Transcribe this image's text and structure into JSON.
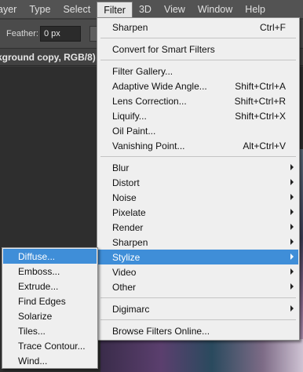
{
  "menubar": {
    "items": [
      "ayer",
      "Type",
      "Select",
      "Filter",
      "3D",
      "View",
      "Window",
      "Help"
    ],
    "active": "Filter"
  },
  "options": {
    "feather_label": "Feather:",
    "feather_value": "0 px"
  },
  "document": {
    "title": "kground copy, RGB/8) *"
  },
  "filter_menu": {
    "sections": [
      [
        {
          "label": "Sharpen",
          "shortcut": "Ctrl+F"
        }
      ],
      [
        {
          "label": "Convert for Smart Filters"
        }
      ],
      [
        {
          "label": "Filter Gallery..."
        },
        {
          "label": "Adaptive Wide Angle...",
          "shortcut": "Shift+Ctrl+A"
        },
        {
          "label": "Lens Correction...",
          "shortcut": "Shift+Ctrl+R"
        },
        {
          "label": "Liquify...",
          "shortcut": "Shift+Ctrl+X"
        },
        {
          "label": "Oil Paint..."
        },
        {
          "label": "Vanishing Point...",
          "shortcut": "Alt+Ctrl+V"
        }
      ],
      [
        {
          "label": "Blur",
          "submenu": true
        },
        {
          "label": "Distort",
          "submenu": true
        },
        {
          "label": "Noise",
          "submenu": true
        },
        {
          "label": "Pixelate",
          "submenu": true
        },
        {
          "label": "Render",
          "submenu": true
        },
        {
          "label": "Sharpen",
          "submenu": true
        },
        {
          "label": "Stylize",
          "submenu": true,
          "highlighted": true
        },
        {
          "label": "Video",
          "submenu": true
        },
        {
          "label": "Other",
          "submenu": true
        }
      ],
      [
        {
          "label": "Digimarc",
          "submenu": true
        }
      ],
      [
        {
          "label": "Browse Filters Online..."
        }
      ]
    ]
  },
  "stylize_submenu": {
    "items": [
      {
        "label": "Diffuse...",
        "highlighted": true
      },
      {
        "label": "Emboss..."
      },
      {
        "label": "Extrude..."
      },
      {
        "label": "Find Edges"
      },
      {
        "label": "Solarize"
      },
      {
        "label": "Tiles..."
      },
      {
        "label": "Trace Contour..."
      },
      {
        "label": "Wind..."
      }
    ]
  },
  "colors": {
    "highlight": "#3f8ed8",
    "menu_bg": "#efefef",
    "menubar_bg": "#535353"
  }
}
